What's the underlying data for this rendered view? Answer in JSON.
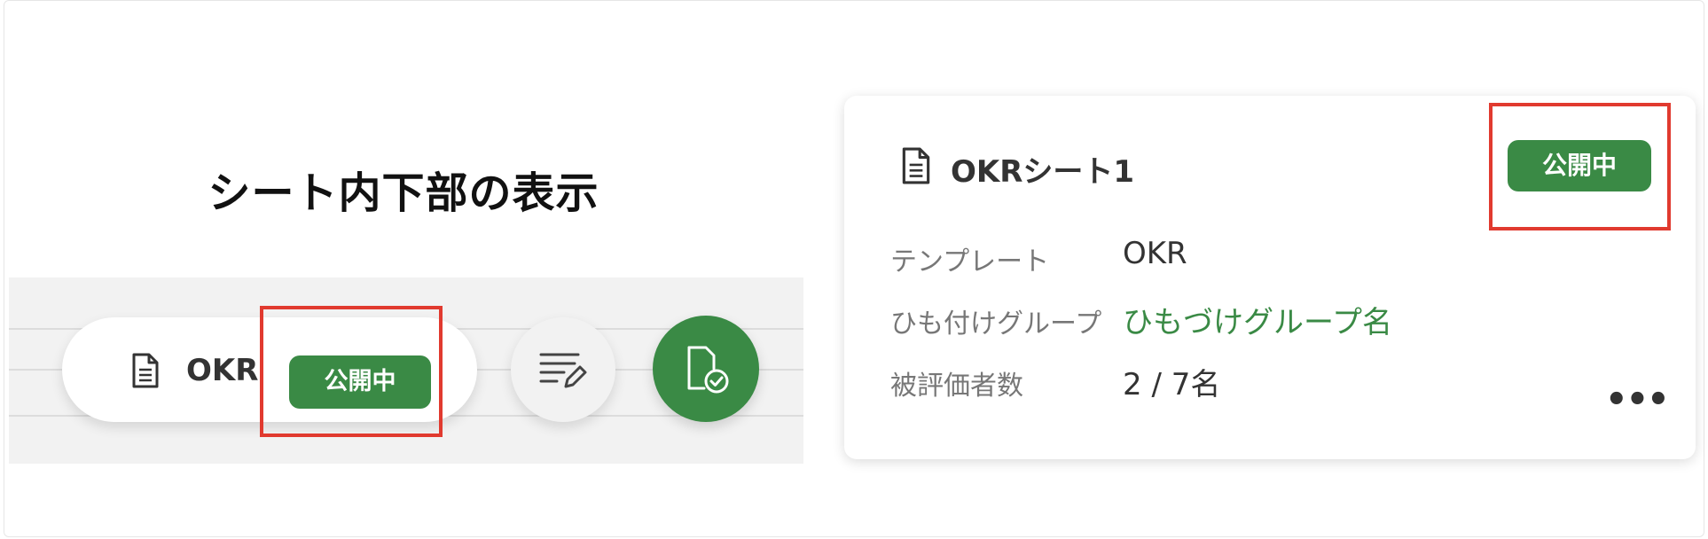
{
  "left_panel": {
    "title": "シート内下部の表示",
    "pill": {
      "label": "OKR",
      "status_badge": "公開中"
    },
    "icons": {
      "doc": "document-icon",
      "edit": "edit-list-icon",
      "publish": "publish-check-icon"
    }
  },
  "card": {
    "title": "OKRシート1",
    "status_badge": "公開中",
    "fields": [
      {
        "label": "テンプレート",
        "value": "OKR"
      },
      {
        "label": "ひも付けグループ",
        "value": "ひもづけグループ名"
      },
      {
        "label": "被評価者数",
        "value": "2 / 7名"
      }
    ],
    "more_label": "•••"
  },
  "colors": {
    "accent_green": "#3a8a45",
    "highlight_red": "#e13a2f"
  }
}
